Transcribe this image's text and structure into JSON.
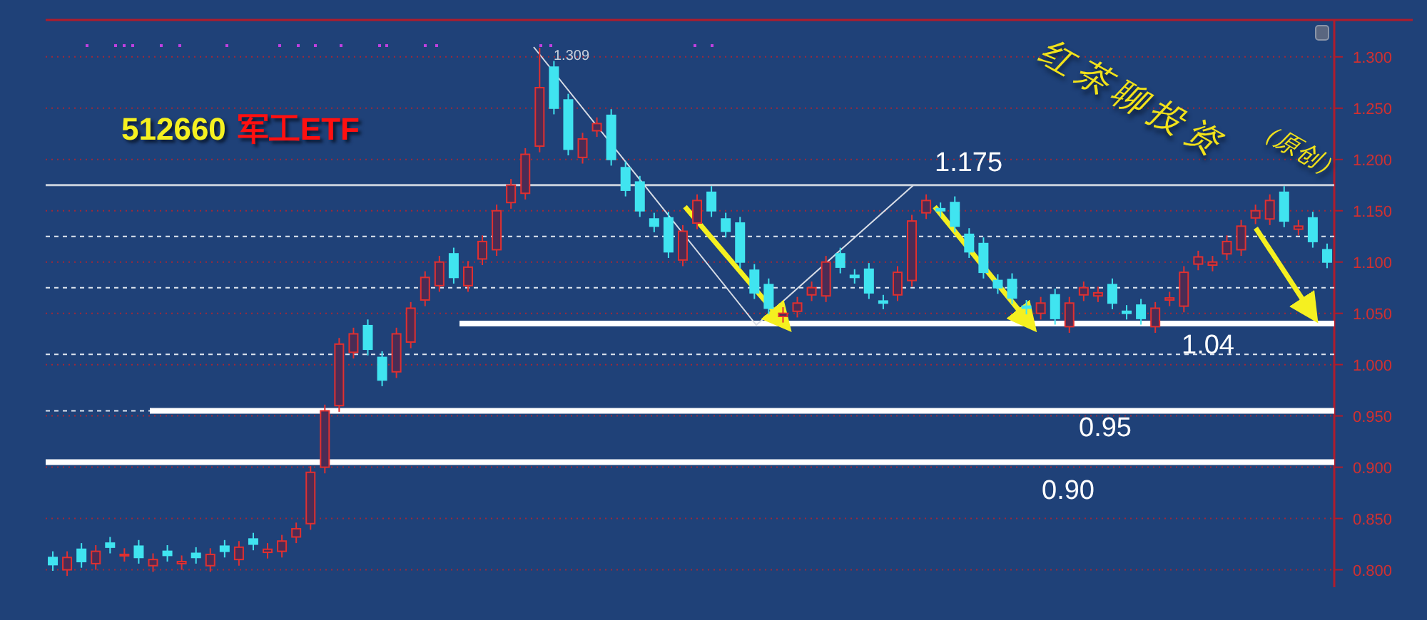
{
  "title": {
    "code": "512660",
    "name": "军工ETF"
  },
  "caption": [
    "红茶聊投资",
    "（原创）"
  ],
  "chart_data": {
    "type": "candlestick",
    "ylim": [
      0.783,
      1.336
    ],
    "yticks": [
      {
        "value": 1.3,
        "label": "1.300"
      },
      {
        "value": 1.25,
        "label": "1.250"
      },
      {
        "value": 1.2,
        "label": "1.200"
      },
      {
        "value": 1.15,
        "label": "1.150"
      },
      {
        "value": 1.1,
        "label": "1.100"
      },
      {
        "value": 1.05,
        "label": "1.050"
      },
      {
        "value": 1.0,
        "label": "1.000"
      },
      {
        "value": 0.95,
        "label": "0.950"
      },
      {
        "value": 0.9,
        "label": "0.900"
      },
      {
        "value": 0.85,
        "label": "0.850"
      },
      {
        "value": 0.8,
        "label": "0.800"
      }
    ],
    "grid": true,
    "categories": [
      null,
      null,
      null,
      null,
      null,
      null,
      null,
      null,
      null,
      null,
      null,
      null,
      null,
      null,
      null,
      null,
      null,
      null,
      null,
      null,
      null,
      null,
      null,
      null,
      null,
      null,
      null,
      null,
      null,
      null,
      null,
      null,
      null,
      null,
      null,
      null,
      null,
      null,
      null,
      null,
      null,
      null,
      null,
      null,
      null,
      null,
      null,
      null,
      null,
      null,
      null,
      null,
      null,
      null,
      null,
      null,
      null,
      null,
      null,
      null,
      null,
      null,
      null,
      null,
      null,
      null,
      null,
      null,
      null,
      null,
      null,
      null,
      null,
      null,
      null,
      null,
      null,
      null,
      null,
      null,
      null,
      null,
      null,
      null,
      null,
      null,
      null,
      null,
      null,
      null
    ],
    "annotations": [
      "1.309"
    ],
    "ref_lines": [
      {
        "axis": "y",
        "value": 1.175,
        "label": "1.175"
      },
      {
        "axis": "y",
        "value": 1.04,
        "label": "1.04"
      },
      {
        "axis": "y",
        "value": 0.955,
        "label": "0.95"
      },
      {
        "axis": "y",
        "value": 0.905,
        "label": "0.90"
      },
      {
        "axis": "y",
        "value": 1.125
      },
      {
        "axis": "y",
        "value": 1.075
      },
      {
        "axis": "y",
        "value": 1.01
      },
      {
        "axis": "y",
        "value": 0.955
      }
    ],
    "ohlc": [
      [
        0.812,
        0.818,
        0.799,
        0.805
      ],
      [
        0.8,
        0.818,
        0.794,
        0.812
      ],
      [
        0.82,
        0.826,
        0.802,
        0.808
      ],
      [
        0.806,
        0.824,
        0.8,
        0.818
      ],
      [
        0.826,
        0.832,
        0.816,
        0.822
      ],
      [
        0.814,
        0.821,
        0.808,
        0.815
      ],
      [
        0.823,
        0.829,
        0.806,
        0.812
      ],
      [
        0.804,
        0.816,
        0.798,
        0.81
      ],
      [
        0.818,
        0.824,
        0.808,
        0.814
      ],
      [
        0.806,
        0.814,
        0.8,
        0.808
      ],
      [
        0.816,
        0.822,
        0.806,
        0.812
      ],
      [
        0.804,
        0.821,
        0.798,
        0.815
      ],
      [
        0.823,
        0.829,
        0.812,
        0.818
      ],
      [
        0.81,
        0.828,
        0.804,
        0.822
      ],
      [
        0.83,
        0.836,
        0.819,
        0.825
      ],
      [
        0.817,
        0.826,
        0.811,
        0.82
      ],
      [
        0.818,
        0.834,
        0.812,
        0.828
      ],
      [
        0.832,
        0.846,
        0.826,
        0.84
      ],
      [
        0.845,
        0.901,
        0.839,
        0.895
      ],
      [
        0.9,
        0.961,
        0.894,
        0.955
      ],
      [
        0.96,
        1.026,
        0.954,
        1.02
      ],
      [
        1.012,
        1.036,
        1.006,
        1.03
      ],
      [
        1.038,
        1.044,
        1.009,
        1.015
      ],
      [
        1.007,
        1.013,
        0.979,
        0.985
      ],
      [
        0.993,
        1.036,
        0.987,
        1.03
      ],
      [
        1.022,
        1.061,
        1.016,
        1.055
      ],
      [
        1.063,
        1.091,
        1.057,
        1.085
      ],
      [
        1.077,
        1.106,
        1.071,
        1.1
      ],
      [
        1.108,
        1.114,
        1.079,
        1.085
      ],
      [
        1.077,
        1.101,
        1.071,
        1.095
      ],
      [
        1.103,
        1.126,
        1.097,
        1.12
      ],
      [
        1.112,
        1.156,
        1.106,
        1.15
      ],
      [
        1.158,
        1.181,
        1.152,
        1.175
      ],
      [
        1.167,
        1.211,
        1.161,
        1.205
      ],
      [
        1.213,
        1.309,
        1.207,
        1.27
      ],
      [
        1.29,
        1.296,
        1.244,
        1.25
      ],
      [
        1.258,
        1.264,
        1.204,
        1.21
      ],
      [
        1.202,
        1.226,
        1.196,
        1.22
      ],
      [
        1.228,
        1.241,
        1.222,
        1.235
      ],
      [
        1.243,
        1.249,
        1.194,
        1.2
      ],
      [
        1.192,
        1.198,
        1.164,
        1.17
      ],
      [
        1.178,
        1.184,
        1.144,
        1.15
      ],
      [
        1.142,
        1.148,
        1.129,
        1.135
      ],
      [
        1.143,
        1.149,
        1.104,
        1.11
      ],
      [
        1.102,
        1.136,
        1.096,
        1.13
      ],
      [
        1.138,
        1.166,
        1.132,
        1.16
      ],
      [
        1.168,
        1.174,
        1.144,
        1.15
      ],
      [
        1.142,
        1.148,
        1.124,
        1.13
      ],
      [
        1.138,
        1.144,
        1.094,
        1.1
      ],
      [
        1.092,
        1.098,
        1.064,
        1.07
      ],
      [
        1.078,
        1.084,
        1.049,
        1.055
      ],
      [
        1.047,
        1.056,
        1.041,
        1.05
      ],
      [
        1.052,
        1.066,
        1.046,
        1.06
      ],
      [
        1.068,
        1.081,
        1.062,
        1.075
      ],
      [
        1.067,
        1.106,
        1.061,
        1.1
      ],
      [
        1.108,
        1.114,
        1.089,
        1.095
      ],
      [
        1.087,
        1.093,
        1.079,
        1.085
      ],
      [
        1.093,
        1.099,
        1.064,
        1.07
      ],
      [
        1.062,
        1.068,
        1.054,
        1.06
      ],
      [
        1.068,
        1.096,
        1.062,
        1.09
      ],
      [
        1.082,
        1.146,
        1.076,
        1.14
      ],
      [
        1.148,
        1.166,
        1.142,
        1.16
      ],
      [
        1.152,
        1.158,
        1.144,
        1.15
      ],
      [
        1.158,
        1.164,
        1.129,
        1.135
      ],
      [
        1.127,
        1.133,
        1.104,
        1.11
      ],
      [
        1.118,
        1.124,
        1.084,
        1.09
      ],
      [
        1.082,
        1.088,
        1.069,
        1.075
      ],
      [
        1.083,
        1.089,
        1.059,
        1.065
      ],
      [
        1.057,
        1.063,
        1.049,
        1.055
      ],
      [
        1.05,
        1.066,
        1.044,
        1.06
      ],
      [
        1.068,
        1.074,
        1.039,
        1.045
      ],
      [
        1.037,
        1.066,
        1.031,
        1.06
      ],
      [
        1.068,
        1.081,
        1.062,
        1.075
      ],
      [
        1.067,
        1.076,
        1.061,
        1.07
      ],
      [
        1.078,
        1.084,
        1.054,
        1.06
      ],
      [
        1.052,
        1.058,
        1.044,
        1.05
      ],
      [
        1.058,
        1.064,
        1.039,
        1.045
      ],
      [
        1.037,
        1.061,
        1.031,
        1.055
      ],
      [
        1.063,
        1.071,
        1.057,
        1.065
      ],
      [
        1.057,
        1.096,
        1.051,
        1.09
      ],
      [
        1.098,
        1.111,
        1.092,
        1.105
      ],
      [
        1.097,
        1.106,
        1.091,
        1.1
      ],
      [
        1.108,
        1.126,
        1.102,
        1.12
      ],
      [
        1.112,
        1.141,
        1.106,
        1.135
      ],
      [
        1.143,
        1.156,
        1.137,
        1.15
      ],
      [
        1.142,
        1.166,
        1.136,
        1.16
      ],
      [
        1.168,
        1.174,
        1.134,
        1.14
      ],
      [
        1.132,
        1.141,
        1.126,
        1.135
      ],
      [
        1.143,
        1.149,
        1.114,
        1.12
      ],
      [
        1.112,
        1.118,
        1.094,
        1.1
      ]
    ]
  }
}
